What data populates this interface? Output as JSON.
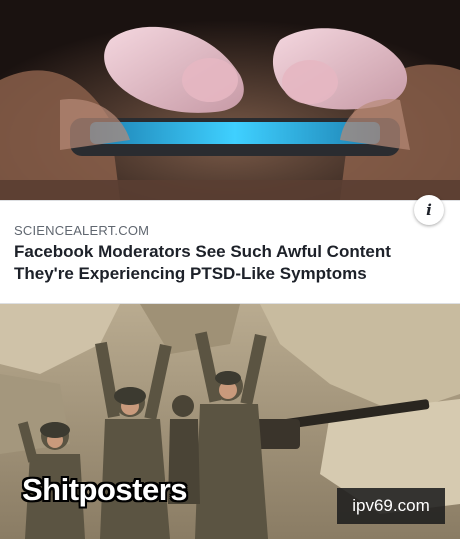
{
  "top_photo": {
    "description_icon": "phone-thumbs-photo"
  },
  "link_card": {
    "domain": "SCIENCEALERT.COM",
    "headline_line1": "Facebook Moderators See Such Awful Content",
    "headline_line2": "They're Experiencing PTSD-Like Symptoms",
    "info_icon": "i"
  },
  "bottom_photo": {
    "caption": "Shitposters",
    "watermark": "ipv69.com"
  },
  "colors": {
    "card_text": "#1d2129",
    "domain_text": "#606770",
    "phone_screen": "#2fb8e8"
  }
}
